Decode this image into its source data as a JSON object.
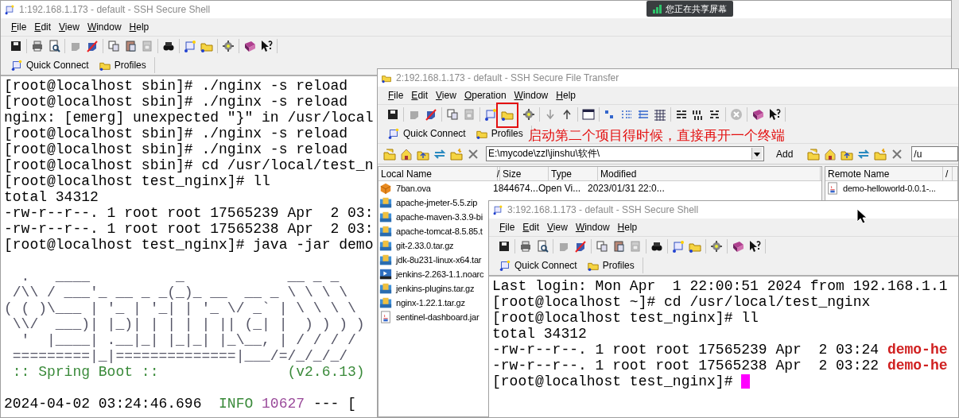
{
  "share_badge": {
    "text": "您正在共享屏幕"
  },
  "windows": [
    {
      "kind": "shell",
      "title": "1:192.168.1.173 - default - SSH Secure Shell",
      "menu": [
        "File",
        "Edit",
        "View",
        "Window",
        "Help"
      ],
      "quick_connect": "Quick Connect",
      "profiles": "Profiles",
      "terminal": [
        [
          {
            "kind": "plain",
            "text": "[root@localhost sbin]# ./nginx -s reload"
          }
        ],
        [
          {
            "kind": "plain",
            "text": "[root@localhost sbin]# ./nginx -s reload"
          }
        ],
        [
          {
            "kind": "plain",
            "text": "nginx: [emerg] unexpected \"}\" in /usr/local"
          }
        ],
        [
          {
            "kind": "plain",
            "text": "[root@localhost sbin]# ./nginx -s reload"
          }
        ],
        [
          {
            "kind": "plain",
            "text": "[root@localhost sbin]# ./nginx -s reload"
          }
        ],
        [
          {
            "kind": "plain",
            "text": "[root@localhost sbin]# cd /usr/local/test_n"
          }
        ],
        [
          {
            "kind": "plain",
            "text": "[root@localhost test_nginx]# ll"
          }
        ],
        [
          {
            "kind": "plain",
            "text": "total 34312"
          }
        ],
        [
          {
            "kind": "plain",
            "text": "-rw-r--r--. 1 root root 17565239 Apr  2 03:"
          }
        ],
        [
          {
            "kind": "plain",
            "text": "-rw-r--r--. 1 root root 17565238 Apr  2 03:"
          }
        ],
        [
          {
            "kind": "plain",
            "text": "[root@localhost test_nginx]# java -jar demo"
          }
        ],
        [
          {
            "kind": "banner",
            "blank_before": true,
            "text": "  .   ____          _            __ _ _\n /\\\\ / ___'_ __ _ _(_)_ __  __ _ \\ \\ \\ \\\n( ( )\\___ | '_ | '_| | '_ \\/ _` | \\ \\ \\ \\\n \\\\/  ___)| |_)| | | | | || (_| |  ) ) ) )\n  '  |____| .__|_| |_|_| |_\\__, | / / / /\n =========|_|==============|___/=/_/_/_/"
          }
        ],
        [
          {
            "kind": "boot",
            "text": " :: Spring Boot ::               (v2.6.13)"
          }
        ],
        [
          {
            "kind": "plain",
            "blank_before": true,
            "text": "2024-04-02 03:24:46.696  "
          },
          {
            "kind": "info",
            "text": "INFO"
          },
          {
            "kind": "pid",
            "text": "10627"
          },
          {
            "kind": "plain",
            "text": " --- ["
          }
        ]
      ]
    },
    {
      "kind": "sftp",
      "title": "2:192.168.1.173 - default - SSH Secure File Transfer",
      "menu": [
        "File",
        "Edit",
        "View",
        "Operation",
        "Window",
        "Help"
      ],
      "quick_connect": "Quick Connect",
      "profiles": "Profiles",
      "local_path": "E:\\mycode\\zzl\\jinshu\\软件\\",
      "add_button": "Add",
      "remote_path": "/u",
      "local_columns": [
        "Local Name",
        "/",
        "Size",
        "Type",
        "Modified"
      ],
      "files": [
        {
          "kind": "disk",
          "name": "7ban.ova",
          "size": "1844674...",
          "type": "Open Vi...",
          "modified": "2023/01/31 22:0..."
        },
        {
          "kind": "archive",
          "name": "apache-jmeter-5.5.zip"
        },
        {
          "kind": "archive",
          "name": "apache-maven-3.3.9-bi"
        },
        {
          "kind": "archive",
          "name": "apache-tomcat-8.5.85.t"
        },
        {
          "kind": "archive",
          "name": "git-2.33.0.tar.gz"
        },
        {
          "kind": "archive",
          "name": "jdk-8u231-linux-x64.tar"
        },
        {
          "kind": "package",
          "name": "jenkins-2.263-1.1.noarc"
        },
        {
          "kind": "archive",
          "name": "jenkins-plugins.tar.gz"
        },
        {
          "kind": "archive",
          "name": "nginx-1.22.1.tar.gz"
        },
        {
          "kind": "jar",
          "name": "sentinel-dashboard.jar"
        }
      ],
      "remote_columns": [
        "Remote Name",
        "/"
      ],
      "remote_files": [
        {
          "kind": "jar",
          "name": "demo-helloworld-0.0.1-..."
        }
      ]
    },
    {
      "kind": "shell",
      "title": "3:192.168.1.173 - default - SSH Secure Shell",
      "menu": [
        "File",
        "Edit",
        "View",
        "Window",
        "Help"
      ],
      "quick_connect": "Quick Connect",
      "profiles": "Profiles",
      "terminal": [
        [
          {
            "kind": "plain",
            "text": "Last login: Mon Apr  1 22:00:51 2024 from 192.168.1.1"
          }
        ],
        [
          {
            "kind": "plain",
            "text": "[root@localhost ~]# cd /usr/local/test_nginx"
          }
        ],
        [
          {
            "kind": "plain",
            "text": "[root@localhost test_nginx]# ll"
          }
        ],
        [
          {
            "kind": "plain",
            "text": "total 34312"
          }
        ],
        [
          {
            "kind": "plain",
            "text": "-rw-r--r--. 1 root root 17565239 Apr  2 03:24 "
          },
          {
            "kind": "file",
            "text": "demo-he"
          }
        ],
        [
          {
            "kind": "plain",
            "text": "-rw-r--r--. 1 root root 17565238 Apr  2 03:22 "
          },
          {
            "kind": "file",
            "text": "demo-he"
          }
        ],
        [
          {
            "kind": "plain",
            "text": "[root@localhost test_nginx]# "
          },
          {
            "kind": "cursor"
          }
        ]
      ]
    }
  ],
  "annotation": {
    "text": "启动第二个项目得时候，直接再开一个终端"
  }
}
